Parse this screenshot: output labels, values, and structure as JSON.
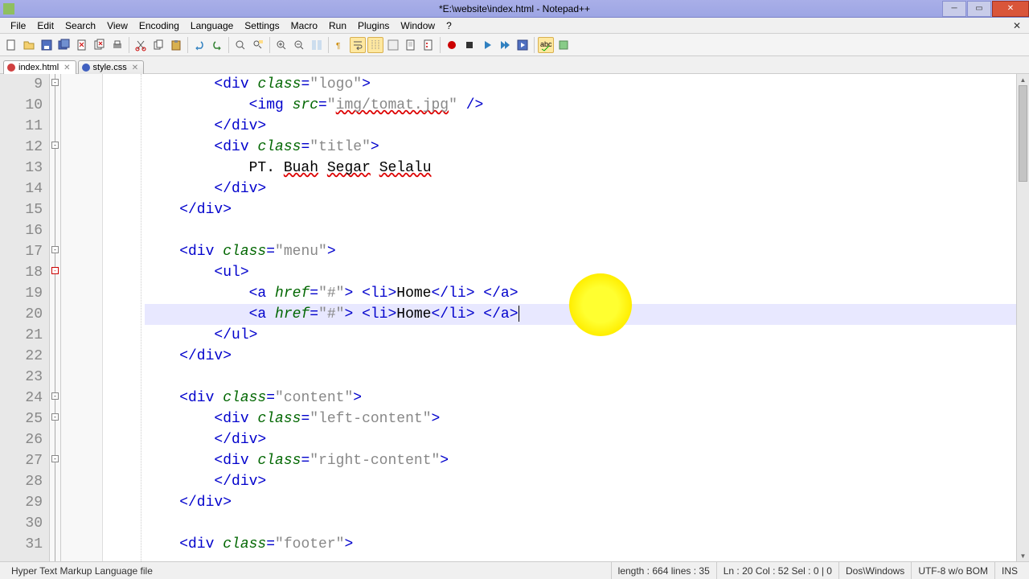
{
  "window": {
    "title": "*E:\\website\\index.html - Notepad++"
  },
  "menu": {
    "file": "File",
    "edit": "Edit",
    "search": "Search",
    "view": "View",
    "encoding": "Encoding",
    "language": "Language",
    "settings": "Settings",
    "macro": "Macro",
    "run": "Run",
    "plugins": "Plugins",
    "window": "Window",
    "help": "?"
  },
  "tabs": {
    "t1": "index.html",
    "t2": "style.css"
  },
  "code": {
    "l9": "        <div class=\"logo\">",
    "l10": "            <img src=\"img/tomat.jpg\" />",
    "l11": "        </div>",
    "l12": "        <div class=\"title\">",
    "l13": "            PT. Buah Segar Selalu",
    "l14": "        </div>",
    "l15": "    </div>",
    "l16": "    ",
    "l17": "    <div class=\"menu\">",
    "l18": "        <ul>",
    "l19": "            <a href=\"#\"> <li>Home</li> </a>",
    "l20": "            <a href=\"#\"> <li>Home</li> </a>",
    "l21": "        </ul>",
    "l22": "    </div>",
    "l23": "    ",
    "l24": "    <div class=\"content\">",
    "l25": "        <div class=\"left-content\">",
    "l26": "        </div>",
    "l27": "        <div class=\"right-content\">",
    "l28": "        </div>",
    "l29": "    </div>",
    "l30": "    ",
    "l31": "    <div class=\"footer\">"
  },
  "linenums": {
    "n9": "9",
    "n10": "10",
    "n11": "11",
    "n12": "12",
    "n13": "13",
    "n14": "14",
    "n15": "15",
    "n16": "16",
    "n17": "17",
    "n18": "18",
    "n19": "19",
    "n20": "20",
    "n21": "21",
    "n22": "22",
    "n23": "23",
    "n24": "24",
    "n25": "25",
    "n26": "26",
    "n27": "27",
    "n28": "28",
    "n29": "29",
    "n30": "30",
    "n31": "31"
  },
  "status": {
    "lang": "Hyper Text Markup Language file",
    "length": "length : 664    lines : 35",
    "pos": "Ln : 20    Col : 52    Sel : 0 | 0",
    "eol": "Dos\\Windows",
    "enc": "UTF-8 w/o BOM",
    "mode": "INS"
  }
}
